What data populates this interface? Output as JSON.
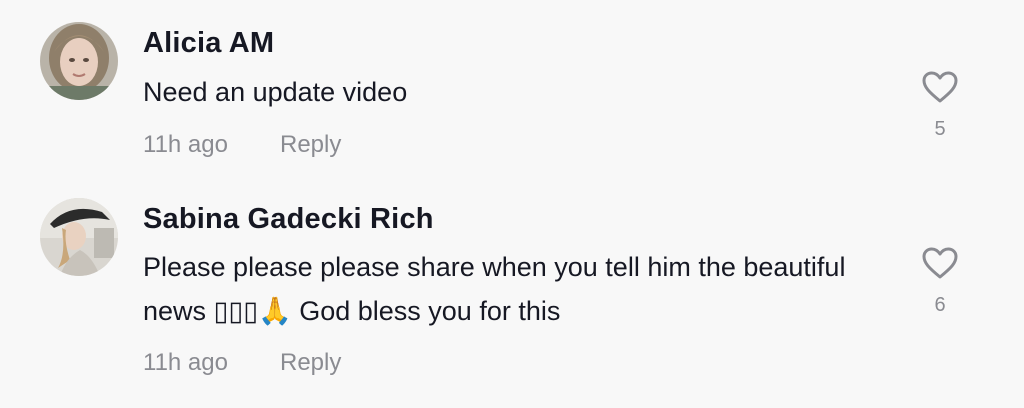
{
  "comments": [
    {
      "username": "Alicia AM",
      "text": "Need an update video",
      "time": "11h ago",
      "reply_label": "Reply",
      "likes": "5",
      "like_icon": "heart-outline-icon"
    },
    {
      "username": "Sabina Gadecki Rich",
      "text": "Please please please share when you tell him the beautiful news ▯▯▯🙏 God bless you for this",
      "time": "11h ago",
      "reply_label": "Reply",
      "likes": "6",
      "like_icon": "heart-outline-icon"
    }
  ],
  "colors": {
    "background": "#f8f8f8",
    "text_primary": "#161823",
    "text_secondary": "#8a8b91"
  }
}
